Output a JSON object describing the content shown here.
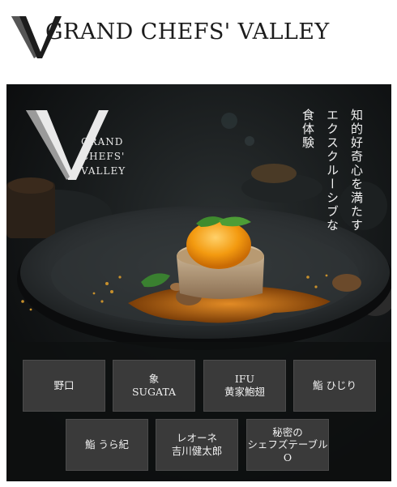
{
  "brand": {
    "logo_letter": "V",
    "name": "GRAND CHEFS' VALLEY",
    "hero_lines": [
      "GRAND",
      "CHEFS'",
      "VALLEY"
    ]
  },
  "hero": {
    "tagline_lines": [
      "知的好奇心を満たす",
      "エクスクルーシブな",
      "食体験"
    ]
  },
  "restaurants": [
    {
      "lines": [
        "野口"
      ]
    },
    {
      "lines": [
        "象",
        "SUGATA"
      ]
    },
    {
      "lines": [
        "IFU",
        "黄家鮑翅"
      ]
    },
    {
      "lines": [
        "鮨 ひじり"
      ]
    },
    {
      "lines": [
        "鮨 うら紀"
      ]
    },
    {
      "lines": [
        "レオーネ",
        "吉川健太郎"
      ]
    },
    {
      "lines": [
        "秘密の",
        "シェフズテーブルO"
      ]
    }
  ],
  "colors": {
    "hero_bg": "#0d0f10",
    "button_bg": "#3a3a3a",
    "sauce": "#c9781f",
    "egg": "#f39a10"
  }
}
